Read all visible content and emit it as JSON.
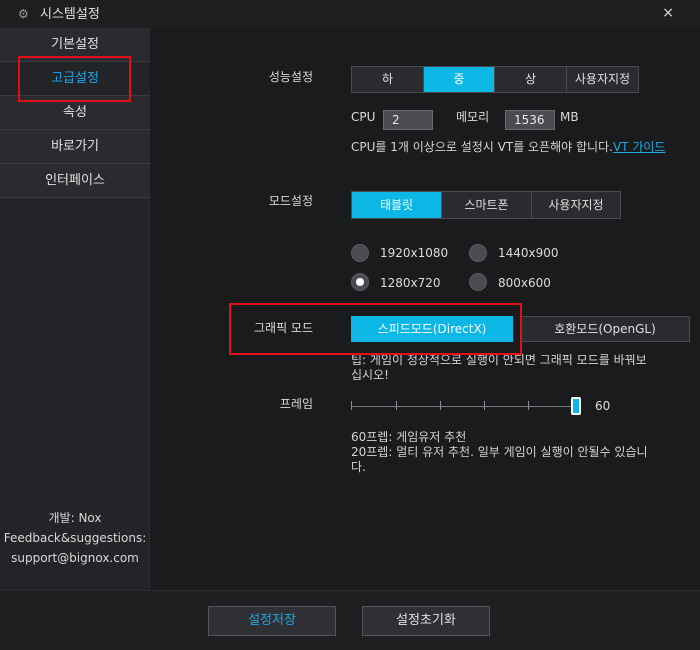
{
  "window": {
    "title": "시스템설정",
    "close": "×"
  },
  "sidebar": {
    "items": [
      {
        "label": "기본설정"
      },
      {
        "label": "고급설정"
      },
      {
        "label": "속성"
      },
      {
        "label": "바로가기"
      },
      {
        "label": "인터페이스"
      }
    ],
    "active_index": 1,
    "footer": {
      "developer": "개발: Nox",
      "feedback": "Feedback&suggestions:",
      "email": "support@bignox.com"
    }
  },
  "performance": {
    "label": "성능설정",
    "options": [
      "하",
      "중",
      "상",
      "사용자지정"
    ],
    "selected": "중",
    "cpu_label": "CPU",
    "cpu_value": "2",
    "memory_label": "메모리",
    "memory_value": "1536",
    "memory_unit": "MB",
    "note": "CPU를 1개 이상으로 설정시 VT를 오픈해야 합니다.",
    "note_link": "VT 가이드"
  },
  "mode": {
    "label": "모드설정",
    "options": [
      "태블릿",
      "스마트폰",
      "사용자지정"
    ],
    "selected": "태블릿",
    "resolutions": [
      "1920x1080",
      "1440x900",
      "1280x720",
      "800x600"
    ],
    "selected_resolution": "1280x720"
  },
  "graphics": {
    "label": "그래픽 모드",
    "options": [
      "스피드모드(DirectX)",
      "호환모드(OpenGL)"
    ],
    "selected": "스피드모드(DirectX)",
    "tip_line1": "팁: 게임이 정상적으로 실행이 안되면 그래픽 모드를 바꿔보",
    "tip_line2": "십시오!"
  },
  "frame": {
    "label": "프레임",
    "value": "60",
    "note_line1": "60프렙: 게임유저 추천",
    "note_line2": "20프렙: 멀티 유저 추천. 일부 게임이 실행이 안될수 있습니",
    "note_line3": "다."
  },
  "footer_buttons": {
    "save": "설정저장",
    "reset": "설정초기화"
  },
  "colors": {
    "accent": "#0cb6e5",
    "highlight_box": "#e0101a",
    "background": "#1a1b1d"
  }
}
